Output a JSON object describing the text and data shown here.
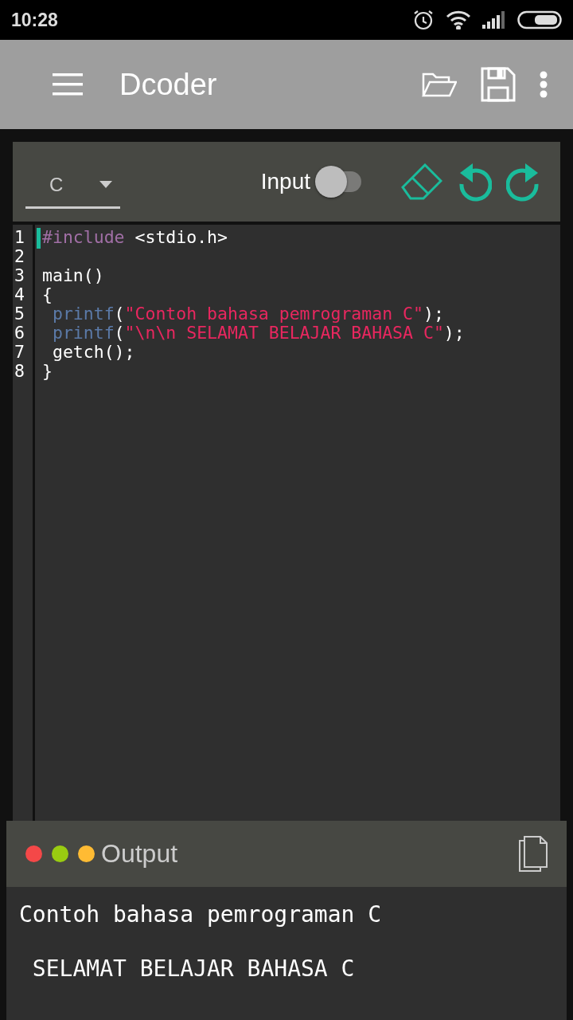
{
  "status_bar": {
    "time": "10:28"
  },
  "app_bar": {
    "title": "Dcoder"
  },
  "editor_toolbar": {
    "language": "C",
    "input_label": "Input",
    "input_on": false
  },
  "code": {
    "lines": [
      {
        "number": "1",
        "tokens": [
          {
            "kind": "preprocessor",
            "text": "#include"
          },
          {
            "kind": "plain",
            "text": " <stdio.h>"
          }
        ]
      },
      {
        "number": "2"
      },
      {
        "number": "3",
        "tokens": [
          {
            "kind": "plain",
            "text": "main()"
          }
        ]
      },
      {
        "number": "4",
        "tokens": [
          {
            "kind": "plain",
            "text": "{"
          }
        ]
      },
      {
        "number": "5",
        "tokens": [
          {
            "kind": "function",
            "text": " printf"
          },
          {
            "kind": "plain",
            "text": "("
          },
          {
            "kind": "string",
            "text": "\"Contoh bahasa pemrograman C\""
          },
          {
            "kind": "plain",
            "text": ");"
          }
        ]
      },
      {
        "number": "6",
        "tokens": [
          {
            "kind": "function",
            "text": " printf"
          },
          {
            "kind": "plain",
            "text": "("
          },
          {
            "kind": "string",
            "text": "\"\\n\\n SELAMAT BELAJAR BAHASA C\""
          },
          {
            "kind": "plain",
            "text": ");"
          }
        ]
      },
      {
        "number": "7",
        "tokens": [
          {
            "kind": "plain",
            "text": " getch();"
          }
        ]
      },
      {
        "number": "8",
        "tokens": [
          {
            "kind": "plain",
            "text": "}"
          }
        ]
      }
    ]
  },
  "output": {
    "title": "Output",
    "dots": [
      {
        "color": "#f44848"
      },
      {
        "color": "#99cc11"
      },
      {
        "color": "#ffbb33"
      }
    ],
    "lines": [
      "Contoh bahasa pemrograman C",
      " SELAMAT BELAJAR BAHASA C"
    ]
  }
}
